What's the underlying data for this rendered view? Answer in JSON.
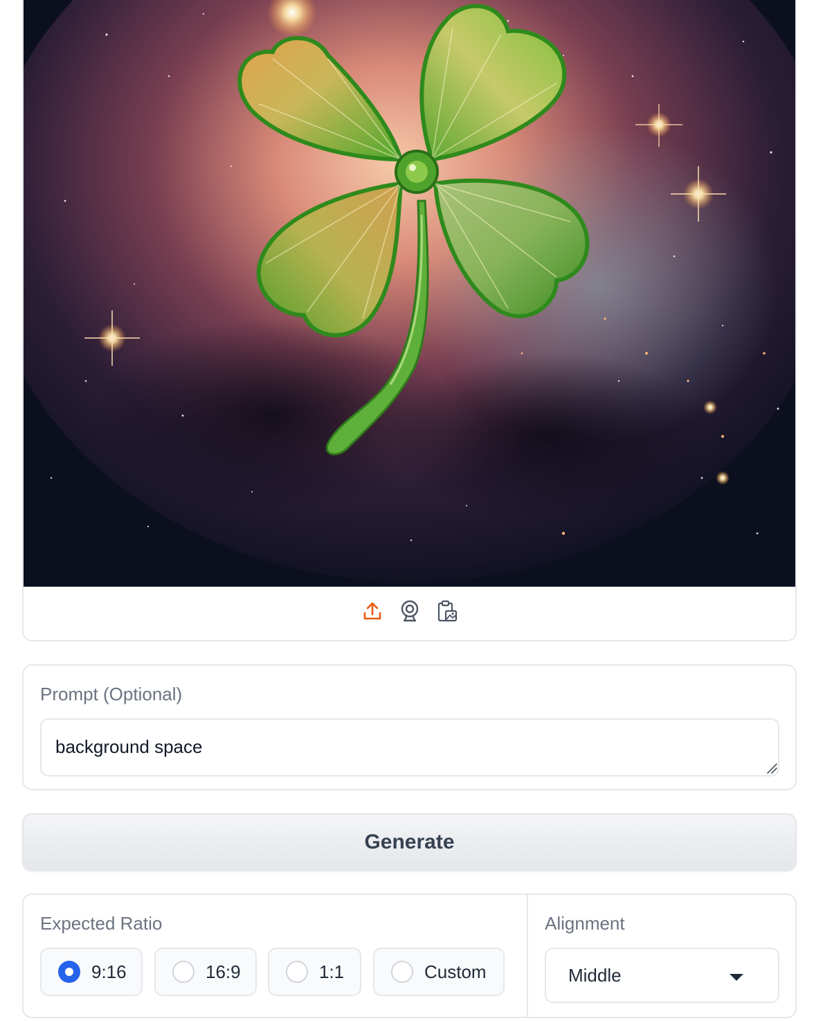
{
  "image_input": {
    "content": "Jeweled green four-leaf clover on a starry space nebula background",
    "source_icons": [
      "upload-icon",
      "webcam-icon",
      "clipboard-image-icon"
    ],
    "accent_color": "#e8590c"
  },
  "prompt": {
    "label": "Prompt (Optional)",
    "value": "background space"
  },
  "generate": {
    "label": "Generate"
  },
  "expected_ratio": {
    "label": "Expected Ratio",
    "options": [
      "9:16",
      "16:9",
      "1:1",
      "Custom"
    ],
    "selected": "9:16",
    "selected_color": "#2563eb"
  },
  "alignment": {
    "label": "Alignment",
    "value": "Middle"
  }
}
